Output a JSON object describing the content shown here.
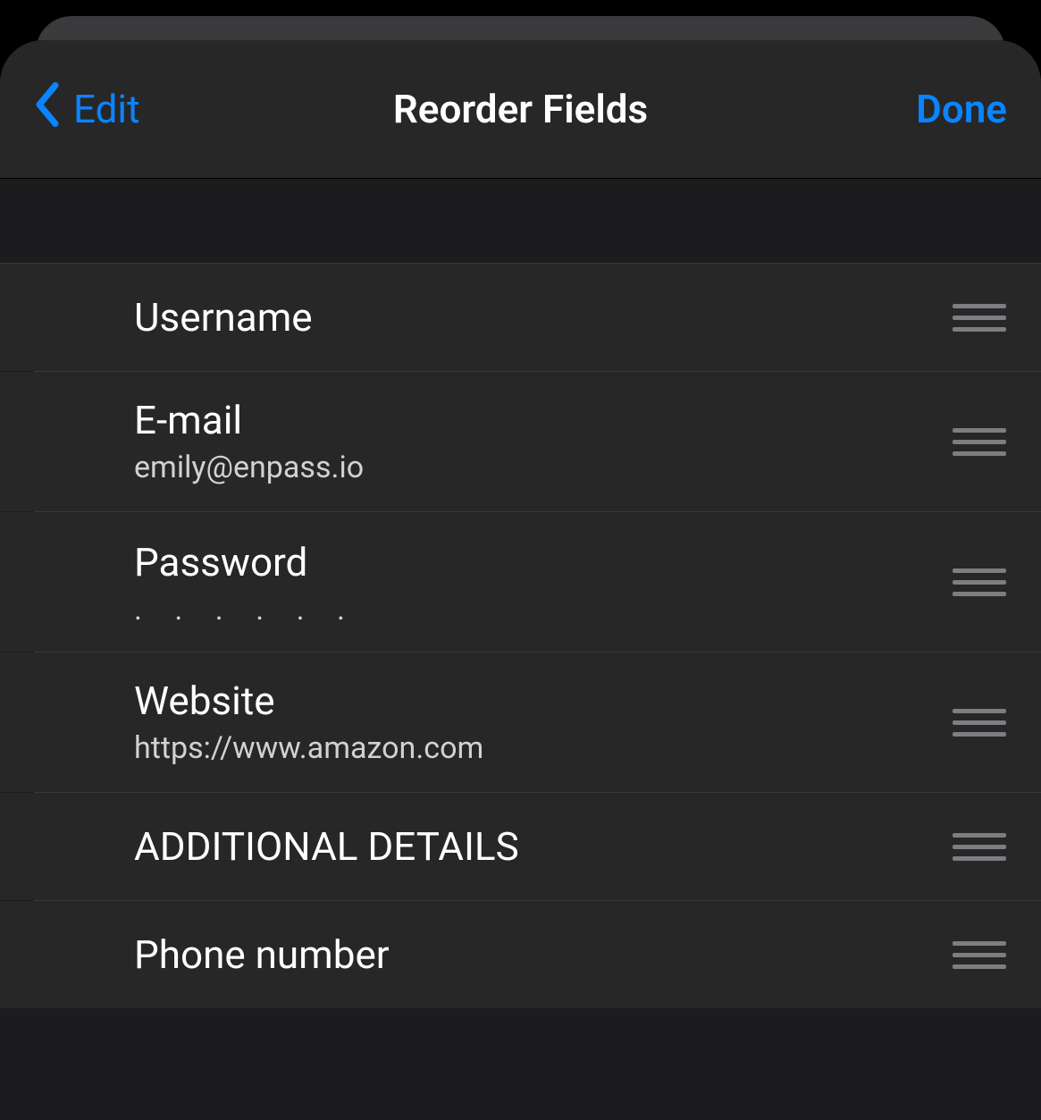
{
  "nav": {
    "back_label": "Edit",
    "title": "Reorder Fields",
    "done_label": "Done"
  },
  "fields": [
    {
      "label": "Username",
      "value": ""
    },
    {
      "label": "E-mail",
      "value": "emily@enpass.io"
    },
    {
      "label": "Password",
      "value": ". . . . . .",
      "masked": true
    },
    {
      "label": "Website",
      "value": "https://www.amazon.com"
    },
    {
      "label": "ADDITIONAL DETAILS",
      "value": ""
    },
    {
      "label": "Phone number",
      "value": ""
    }
  ]
}
